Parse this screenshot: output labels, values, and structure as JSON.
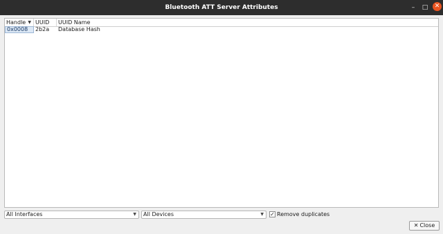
{
  "window": {
    "title": "Bluetooth ATT Server Attributes",
    "controls": {
      "minimize": "–",
      "maximize": "□",
      "close": "✕"
    }
  },
  "table": {
    "columns": [
      "Handle",
      "UUID",
      "UUID Name"
    ],
    "sort_indicator": "▼",
    "rows": [
      {
        "handle": "0x0008",
        "uuid": "2b2a",
        "uuid_name": "Database Hash"
      }
    ]
  },
  "filters": {
    "interface": "All Interfaces",
    "device": "All Devices",
    "remove_duplicates": {
      "label": "Remove duplicates",
      "checked": true
    }
  },
  "buttons": {
    "close": "Close"
  },
  "colors": {
    "titlebar": "#2d2d2d",
    "close_accent": "#e95420",
    "selection": "#dce8f5"
  },
  "icons": {
    "dropdown": "chevron-down-icon",
    "check": "checkmark-icon",
    "close": "x-icon"
  }
}
